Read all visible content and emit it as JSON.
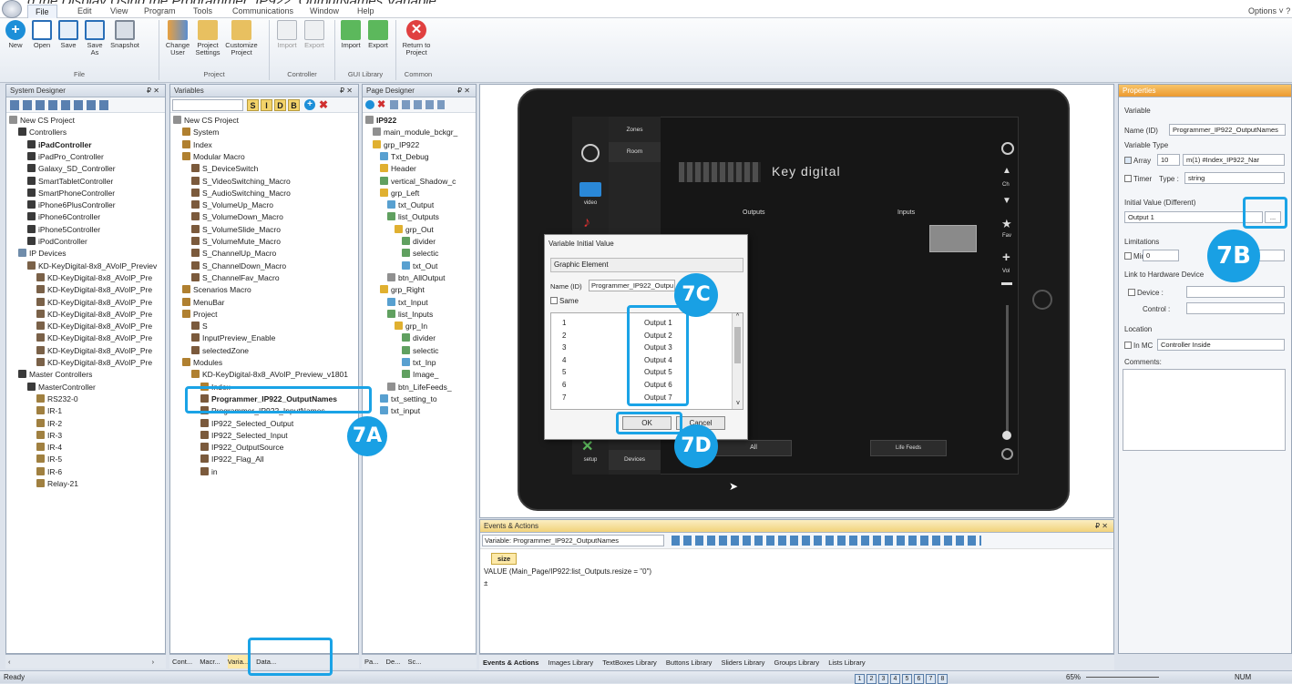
{
  "title_partial": "g the Display Using the Programmer_IP922_OutputNames Variable",
  "menu": {
    "items": [
      "File",
      "Edit",
      "View",
      "Program",
      "Tools",
      "Communications",
      "Window",
      "Help"
    ],
    "options": "Options ˅ ?"
  },
  "ribbon": {
    "buttons": [
      {
        "label": "New",
        "icon": "new-icon"
      },
      {
        "label": "Open",
        "icon": "open-icon"
      },
      {
        "label": "Save",
        "icon": "save-icon"
      },
      {
        "label": "Save\nAs",
        "icon": "save-as-icon"
      },
      {
        "label": "Snapshot",
        "icon": "snapshot-icon"
      },
      {
        "label": "Change\nUser",
        "icon": "change-user-icon"
      },
      {
        "label": "Project\nSettings",
        "icon": "project-settings-icon"
      },
      {
        "label": "Customize\nProject",
        "icon": "customize-project-icon"
      },
      {
        "label": "Import",
        "icon": "import-icon"
      },
      {
        "label": "Export",
        "icon": "export-icon"
      },
      {
        "label": "Import",
        "icon": "gui-import-icon"
      },
      {
        "label": "Export",
        "icon": "gui-export-icon"
      },
      {
        "label": "Return to\nProject",
        "icon": "return-icon"
      }
    ],
    "groups": [
      "File",
      "Project",
      "Controller",
      "GUI Library",
      "Common"
    ]
  },
  "system_designer": {
    "title": "System Designer",
    "pin": "₽ ✕",
    "tree": [
      {
        "label": "New CS Project",
        "level": 0,
        "icon": "ic-pg"
      },
      {
        "label": "Controllers",
        "level": 1,
        "icon": "ic-ctrl"
      },
      {
        "label": "iPadController",
        "level": 2,
        "icon": "ic-ctrl",
        "bold": true
      },
      {
        "label": "iPadPro_Controller",
        "level": 2,
        "icon": "ic-ctrl"
      },
      {
        "label": "Galaxy_SD_Controller",
        "level": 2,
        "icon": "ic-ctrl"
      },
      {
        "label": "SmartTabletController",
        "level": 2,
        "icon": "ic-ctrl"
      },
      {
        "label": "SmartPhoneController",
        "level": 2,
        "icon": "ic-ctrl"
      },
      {
        "label": "iPhone6PlusController",
        "level": 2,
        "icon": "ic-ctrl"
      },
      {
        "label": "iPhone6Controller",
        "level": 2,
        "icon": "ic-ctrl"
      },
      {
        "label": "iPhone5Controller",
        "level": 2,
        "icon": "ic-ctrl"
      },
      {
        "label": "iPodController",
        "level": 2,
        "icon": "ic-ctrl"
      },
      {
        "label": "IP Devices",
        "level": 1,
        "icon": "ic-ip"
      },
      {
        "label": "KD-KeyDigital-8x8_AVoIP_Previev",
        "level": 2,
        "icon": "ic-dev"
      },
      {
        "label": "KD-KeyDigital-8x8_AVoIP_Pre",
        "level": 3,
        "icon": "ic-dev"
      },
      {
        "label": "KD-KeyDigital-8x8_AVoIP_Pre",
        "level": 3,
        "icon": "ic-dev"
      },
      {
        "label": "KD-KeyDigital-8x8_AVoIP_Pre",
        "level": 3,
        "icon": "ic-dev"
      },
      {
        "label": "KD-KeyDigital-8x8_AVoIP_Pre",
        "level": 3,
        "icon": "ic-dev"
      },
      {
        "label": "KD-KeyDigital-8x8_AVoIP_Pre",
        "level": 3,
        "icon": "ic-dev"
      },
      {
        "label": "KD-KeyDigital-8x8_AVoIP_Pre",
        "level": 3,
        "icon": "ic-dev"
      },
      {
        "label": "KD-KeyDigital-8x8_AVoIP_Pre",
        "level": 3,
        "icon": "ic-dev"
      },
      {
        "label": "KD-KeyDigital-8x8_AVoIP_Pre",
        "level": 3,
        "icon": "ic-dev"
      },
      {
        "label": "Master Controllers",
        "level": 1,
        "icon": "ic-ctrl"
      },
      {
        "label": "MasterController",
        "level": 2,
        "icon": "ic-ctrl"
      },
      {
        "label": "RS232-0",
        "level": 3,
        "icon": "ic-ir"
      },
      {
        "label": "IR-1",
        "level": 3,
        "icon": "ic-ir"
      },
      {
        "label": "IR-2",
        "level": 3,
        "icon": "ic-ir"
      },
      {
        "label": "IR-3",
        "level": 3,
        "icon": "ic-ir"
      },
      {
        "label": "IR-4",
        "level": 3,
        "icon": "ic-ir"
      },
      {
        "label": "IR-5",
        "level": 3,
        "icon": "ic-ir"
      },
      {
        "label": "IR-6",
        "level": 3,
        "icon": "ic-ir"
      },
      {
        "label": "Relay-21",
        "level": 3,
        "icon": "ic-ir"
      }
    ],
    "tabs": [
      "Cont...",
      "Macr...",
      "Varia...",
      "Data..."
    ]
  },
  "variables": {
    "title": "Variables",
    "pin": "₽ ✕",
    "filter_letters": [
      "S",
      "I",
      "D",
      "B"
    ],
    "tree": [
      {
        "label": "New CS Project",
        "level": 0,
        "icon": "ic-pg"
      },
      {
        "label": "System",
        "level": 1,
        "icon": "ic-mod"
      },
      {
        "label": "Index",
        "level": 1,
        "icon": "ic-mod"
      },
      {
        "label": "Modular Macro",
        "level": 1,
        "icon": "ic-mod"
      },
      {
        "label": "S_DeviceSwitch",
        "level": 2,
        "icon": "ic-var"
      },
      {
        "label": "S_VideoSwitching_Macro",
        "level": 2,
        "icon": "ic-var"
      },
      {
        "label": "S_AudioSwitching_Macro",
        "level": 2,
        "icon": "ic-var"
      },
      {
        "label": "S_VolumeUp_Macro",
        "level": 2,
        "icon": "ic-var"
      },
      {
        "label": "S_VolumeDown_Macro",
        "level": 2,
        "icon": "ic-var"
      },
      {
        "label": "S_VolumeSlide_Macro",
        "level": 2,
        "icon": "ic-var"
      },
      {
        "label": "S_VolumeMute_Macro",
        "level": 2,
        "icon": "ic-var"
      },
      {
        "label": "S_ChannelUp_Macro",
        "level": 2,
        "icon": "ic-var"
      },
      {
        "label": "S_ChannelDown_Macro",
        "level": 2,
        "icon": "ic-var"
      },
      {
        "label": "S_ChannelFav_Macro",
        "level": 2,
        "icon": "ic-var"
      },
      {
        "label": "Scenarios Macro",
        "level": 1,
        "icon": "ic-mod"
      },
      {
        "label": "MenuBar",
        "level": 1,
        "icon": "ic-mod"
      },
      {
        "label": "Project",
        "level": 1,
        "icon": "ic-mod"
      },
      {
        "label": "S",
        "level": 2,
        "icon": "ic-var"
      },
      {
        "label": "InputPreview_Enable",
        "level": 2,
        "icon": "ic-var"
      },
      {
        "label": "selectedZone",
        "level": 2,
        "icon": "ic-var"
      },
      {
        "label": "Modules",
        "level": 1,
        "icon": "ic-mod"
      },
      {
        "label": "KD-KeyDigital-8x8_AVoIP_Preview_v1801",
        "level": 2,
        "icon": "ic-mod"
      },
      {
        "label": "Index",
        "level": 3,
        "icon": "ic-mod"
      },
      {
        "label": "Programmer_IP922_OutputNames",
        "level": 3,
        "icon": "ic-var",
        "bold": true
      },
      {
        "label": "Programmer_IP922_InputNames",
        "level": 3,
        "icon": "ic-var"
      },
      {
        "label": "IP922_Selected_Output",
        "level": 3,
        "icon": "ic-var"
      },
      {
        "label": "IP922_Selected_Input",
        "level": 3,
        "icon": "ic-var"
      },
      {
        "label": "IP922_OutputSource",
        "level": 3,
        "icon": "ic-var"
      },
      {
        "label": "IP922_Flag_All",
        "level": 3,
        "icon": "ic-var"
      },
      {
        "label": "in",
        "level": 3,
        "icon": "ic-var"
      }
    ]
  },
  "page_designer": {
    "title": "Page Designer",
    "pin": "₽ ✕",
    "tree": [
      {
        "label": "IP922",
        "level": 0,
        "icon": "ic-pg",
        "bold": true
      },
      {
        "label": "main_module_bckgr_",
        "level": 1,
        "icon": "ic-pg"
      },
      {
        "label": "grp_IP922",
        "level": 1,
        "icon": "ic-grp"
      },
      {
        "label": "Txt_Debug",
        "level": 2,
        "icon": "ic-txt"
      },
      {
        "label": "Header",
        "level": 2,
        "icon": "ic-grp"
      },
      {
        "label": "vertical_Shadow_c",
        "level": 2,
        "icon": "ic-lst"
      },
      {
        "label": "grp_Left",
        "level": 2,
        "icon": "ic-grp"
      },
      {
        "label": "txt_Output",
        "level": 3,
        "icon": "ic-txt"
      },
      {
        "label": "list_Outputs",
        "level": 3,
        "icon": "ic-lst"
      },
      {
        "label": "grp_Out",
        "level": 4,
        "icon": "ic-grp"
      },
      {
        "label": "divider",
        "level": 5,
        "icon": "ic-lst"
      },
      {
        "label": "selectic",
        "level": 5,
        "icon": "ic-lst"
      },
      {
        "label": "txt_Out",
        "level": 5,
        "icon": "ic-txt"
      },
      {
        "label": "btn_AllOutput",
        "level": 3,
        "icon": "ic-pg"
      },
      {
        "label": "grp_Right",
        "level": 2,
        "icon": "ic-grp"
      },
      {
        "label": "txt_Input",
        "level": 3,
        "icon": "ic-txt"
      },
      {
        "label": "list_Inputs",
        "level": 3,
        "icon": "ic-lst"
      },
      {
        "label": "grp_In",
        "level": 4,
        "icon": "ic-grp"
      },
      {
        "label": "divider",
        "level": 5,
        "icon": "ic-lst"
      },
      {
        "label": "selectic",
        "level": 5,
        "icon": "ic-lst"
      },
      {
        "label": "txt_Inp",
        "level": 5,
        "icon": "ic-txt"
      },
      {
        "label": "Image_",
        "level": 5,
        "icon": "ic-lst"
      },
      {
        "label": "btn_LifeFeeds_",
        "level": 3,
        "icon": "ic-pg"
      },
      {
        "label": "txt_setting_to",
        "level": 2,
        "icon": "ic-txt"
      },
      {
        "label": "txt_input",
        "level": 2,
        "icon": "ic-txt"
      }
    ],
    "tabs": [
      "Pa...",
      "De...",
      "Sc..."
    ]
  },
  "tablet": {
    "zones_label": "Zones",
    "room_label": "Room",
    "video_label": "video",
    "setup_label": "setup",
    "devices_label": "Devices",
    "outputs_label": "Outputs",
    "inputs_label": "Inputs",
    "all_label": "All",
    "life_feeds_label": "Life Feeds",
    "brand": "Key digital",
    "right_icons": [
      "Ch",
      "Fav",
      "Vol"
    ]
  },
  "dialog": {
    "title": "Variable Initial Value",
    "section": "Graphic Element",
    "name_label": "Name (ID)",
    "name_value": "Programmer_IP922_Outpu",
    "same_label": "Same",
    "rows": [
      {
        "index": "1",
        "value": "Output 1"
      },
      {
        "index": "2",
        "value": "Output 2"
      },
      {
        "index": "3",
        "value": "Output 3"
      },
      {
        "index": "4",
        "value": "Output 4"
      },
      {
        "index": "5",
        "value": "Output 5"
      },
      {
        "index": "6",
        "value": "Output 6"
      },
      {
        "index": "7",
        "value": "Output 7"
      }
    ],
    "ok": "OK",
    "cancel": "Cancel"
  },
  "callouts": {
    "a": "7A",
    "b": "7B",
    "c": "7C",
    "d": "7D"
  },
  "events": {
    "title": "Events & Actions",
    "pin": "₽ ✕",
    "variable_select": "Variable: Programmer_IP922_OutputNames",
    "tab": "size",
    "line1": "VALUE  (Main_Page/IP922:list_Outputs.resize = \"0\")",
    "line2": "±"
  },
  "bottom_tabs": [
    "Events & Actions",
    "Images Library",
    "TextBoxes Library",
    "Buttons Library",
    "Sliders Library",
    "Groups Library",
    "Lists Library"
  ],
  "properties": {
    "title": "Properties",
    "section": "Variable",
    "name_label": "Name (ID)",
    "name_value": "Programmer_IP922_OutputNames",
    "type_label": "Variable Type",
    "array_label": "Array",
    "array_size": "10",
    "array_map": "m(1) #Index_IP922_Nar",
    "timer_label": "Timer",
    "type_field_label": "Type :",
    "type_value": "string",
    "initial_label": "Initial Value (Different)",
    "initial_value": "Output 1",
    "browse": "...",
    "limitations_label": "Limitations",
    "min_label": "Min",
    "min_value": "0",
    "link_label": "Link to Hardware Device",
    "device_label": "Device :",
    "control_label": "Control :",
    "location_label": "Location",
    "inmc_label": "In MC",
    "location_value": "Controller Inside",
    "comments_label": "Comments:"
  },
  "status": {
    "ready": "Ready",
    "pages": [
      "1",
      "2",
      "3",
      "4",
      "5",
      "6",
      "7",
      "8"
    ],
    "zoom": "65%",
    "num": "NUM"
  }
}
